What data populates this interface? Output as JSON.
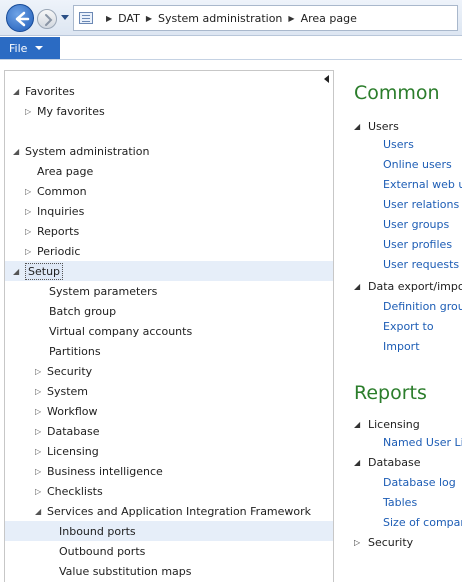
{
  "breadcrumb": [
    "DAT",
    "System administration",
    "Area page"
  ],
  "file_menu": {
    "label": "File"
  },
  "nav": {
    "favorites": {
      "label": "Favorites",
      "items": [
        "My favorites"
      ]
    },
    "system_admin": {
      "label": "System administration"
    },
    "area_page": "Area page",
    "common": "Common",
    "inquiries": "Inquiries",
    "reports": "Reports",
    "periodic": "Periodic",
    "setup": "Setup",
    "setup_items": [
      "System parameters",
      "Batch group",
      "Virtual company accounts",
      "Partitions"
    ],
    "setup_groups": [
      "Security",
      "System",
      "Workflow",
      "Database",
      "Licensing",
      "Business intelligence",
      "Checklists"
    ],
    "services_group": "Services and Application Integration Framework",
    "services_items": [
      "Inbound ports",
      "Outbound ports",
      "Value substitution maps"
    ]
  },
  "content": {
    "common_title": "Common",
    "users_group": "Users",
    "users_links": [
      "Users",
      "Online users",
      "External web us",
      "User relations",
      "User groups",
      "User profiles",
      "User requests"
    ],
    "data_export_group": "Data export/impo",
    "data_export_links": [
      "Definition grou",
      "Export to",
      "Import"
    ],
    "reports_title": "Reports",
    "licensing_group": "Licensing",
    "licensing_links": [
      "Named User Lic"
    ],
    "database_group": "Database",
    "database_links": [
      "Database log",
      "Tables",
      "Size of compan"
    ],
    "security_group": "Security"
  }
}
